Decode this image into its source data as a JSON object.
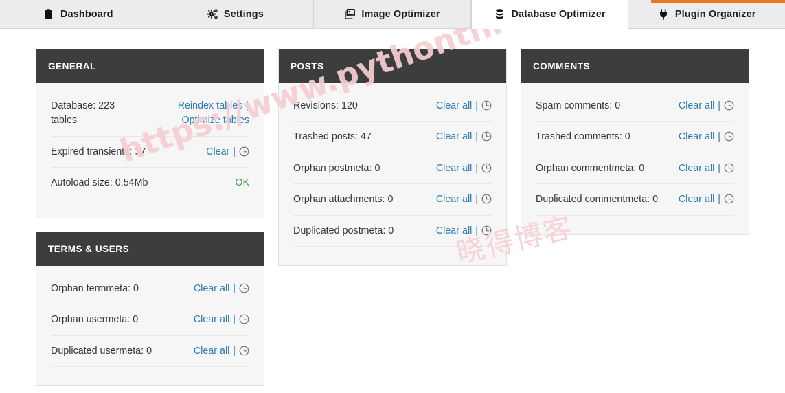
{
  "theme": {
    "accent_orange": "#ec7522",
    "panel_header_bg": "#3d3d3d",
    "panel_body_bg": "#f6f6f6",
    "link_color": "#2b7bb9",
    "ok_color": "#3f9c54",
    "text_color": "#32373c"
  },
  "tabs": [
    {
      "label": "Dashboard",
      "icon": "clipboard-icon",
      "active": false
    },
    {
      "label": "Settings",
      "icon": "gears-icon",
      "active": false
    },
    {
      "label": "Image Optimizer",
      "icon": "images-icon",
      "active": false
    },
    {
      "label": "Database Optimizer",
      "icon": "database-icon",
      "active": true
    },
    {
      "label": "Plugin Organizer",
      "icon": "plug-icon",
      "active": false
    }
  ],
  "labels": {
    "clear": "Clear",
    "clear_all": "Clear all",
    "separator": "|",
    "reindex_tables": "Reindex tables",
    "optimize_tables": "Optimize tables",
    "status_ok": "OK",
    "schedule_icon": "clock-icon"
  },
  "panels": [
    {
      "id": "general",
      "title": "GENERAL",
      "rows": [
        {
          "label": "Database:",
          "value": "223 tables",
          "actions": "reindex-optimize"
        },
        {
          "label": "Expired transients:",
          "value": "37",
          "actions": "clear-clock"
        },
        {
          "label": "Autoload size:",
          "value": "0.54Mb",
          "actions": "status-ok"
        }
      ]
    },
    {
      "id": "posts",
      "title": "POSTS",
      "rows": [
        {
          "label": "Revisions:",
          "value": "120",
          "actions": "clearall-clock"
        },
        {
          "label": "Trashed posts:",
          "value": "47",
          "actions": "clearall-clock"
        },
        {
          "label": "Orphan postmeta:",
          "value": "0",
          "actions": "clearall-clock"
        },
        {
          "label": "Orphan attachments:",
          "value": "0",
          "actions": "clearall-clock"
        },
        {
          "label": "Duplicated postmeta:",
          "value": "0",
          "actions": "clearall-clock"
        }
      ]
    },
    {
      "id": "comments",
      "title": "COMMENTS",
      "rows": [
        {
          "label": "Spam comments:",
          "value": "0",
          "actions": "clearall-clock"
        },
        {
          "label": "Trashed comments:",
          "value": "0",
          "actions": "clearall-clock"
        },
        {
          "label": "Orphan commentmeta:",
          "value": "0",
          "actions": "clearall-clock"
        },
        {
          "label": "Duplicated commentmeta:",
          "value": "0",
          "actions": "clearall-clock"
        }
      ]
    },
    {
      "id": "terms-users",
      "title": "TERMS & USERS",
      "rows": [
        {
          "label": "Orphan termmeta:",
          "value": "0",
          "actions": "clearall-clock"
        },
        {
          "label": "Orphan usermeta:",
          "value": "0",
          "actions": "clearall-clock"
        },
        {
          "label": "Duplicated usermeta:",
          "value": "0",
          "actions": "clearall-clock"
        }
      ]
    }
  ],
  "watermark": {
    "url": "https://www.pythonthree.com",
    "chinese": "晓得博客"
  }
}
